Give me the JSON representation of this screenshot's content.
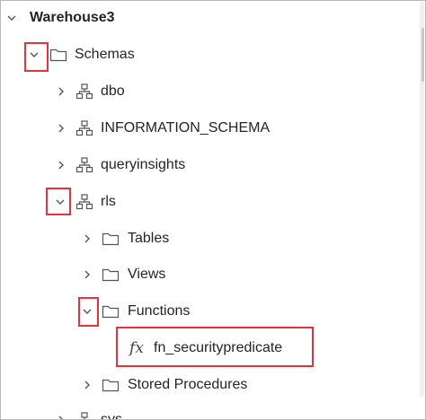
{
  "tree": {
    "warehouse": {
      "label": "Warehouse3"
    },
    "schemas": {
      "label": "Schemas"
    },
    "schema_items": [
      {
        "label": "dbo"
      },
      {
        "label": "INFORMATION_SCHEMA"
      },
      {
        "label": "queryinsights"
      },
      {
        "label": "rls"
      }
    ],
    "rls_children": [
      {
        "label": "Tables"
      },
      {
        "label": "Views"
      },
      {
        "label": "Functions"
      },
      {
        "label": "Stored Procedures"
      }
    ],
    "function_item": {
      "label": "fn_securitypredicate",
      "icon_text": "fx"
    },
    "cut_off": {
      "label": "sys"
    }
  },
  "colors": {
    "highlight": "#e3343b",
    "text": "#242424",
    "icon": "#444444"
  }
}
